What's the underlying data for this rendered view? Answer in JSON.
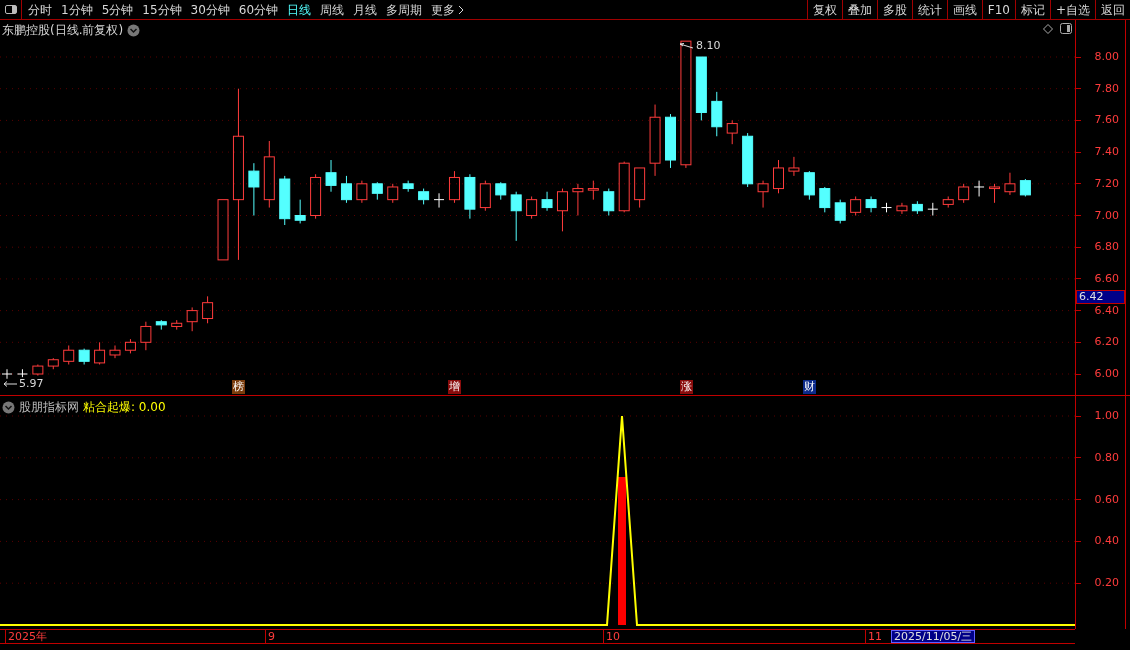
{
  "toolbar": {
    "periods": [
      {
        "label": "分时",
        "selected": false
      },
      {
        "label": "1分钟",
        "selected": false
      },
      {
        "label": "5分钟",
        "selected": false
      },
      {
        "label": "15分钟",
        "selected": false
      },
      {
        "label": "30分钟",
        "selected": false
      },
      {
        "label": "60分钟",
        "selected": false
      },
      {
        "label": "日线",
        "selected": true
      },
      {
        "label": "周线",
        "selected": false
      },
      {
        "label": "月线",
        "selected": false
      },
      {
        "label": "多周期",
        "selected": false
      },
      {
        "label": "更多",
        "selected": false
      }
    ],
    "buttons": [
      "复权",
      "叠加",
      "多股",
      "统计",
      "画线",
      "F10",
      "标记",
      "+自选",
      "返回"
    ]
  },
  "main_chart": {
    "title": "东鹏控股(日线.前复权)",
    "y_axis": [
      "8.00",
      "7.80",
      "7.60",
      "7.40",
      "7.20",
      "7.00",
      "6.80",
      "6.60",
      "6.40",
      "6.20",
      "6.00"
    ],
    "current_price": "6.42",
    "high_label": "8.10",
    "low_label": "5.97",
    "markers": [
      {
        "text": "榜",
        "color": "#7a3c0c"
      },
      {
        "text": "增",
        "color": "#8a0c0c"
      },
      {
        "text": "涨",
        "color": "#8a0c0c"
      },
      {
        "text": "财",
        "color": "#0c2a8a"
      }
    ]
  },
  "indicator": {
    "source": "股朋指标网",
    "name": "粘合起爆: 0.00",
    "y_axis": [
      "1.00",
      "0.80",
      "0.60",
      "0.40",
      "0.20"
    ]
  },
  "time_axis": {
    "labels": [
      "2025年",
      "9",
      "10",
      "11"
    ],
    "cursor_date": "2025/11/05/三"
  }
}
